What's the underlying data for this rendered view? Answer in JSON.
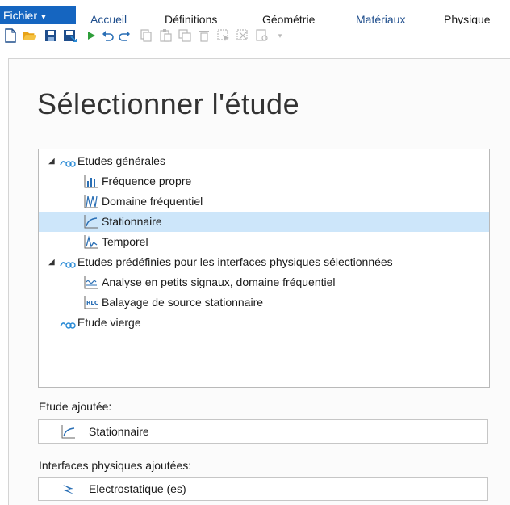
{
  "ribbon": {
    "file_tab": "Fichier",
    "tabs": [
      "Accueil",
      "Définitions",
      "Géométrie",
      "Matériaux",
      "Physique"
    ]
  },
  "toolbar": {
    "icons": [
      "new-file-icon",
      "open-folder-icon",
      "save-icon",
      "save-as-icon",
      "run-icon",
      "undo-icon",
      "redo-icon",
      "copy-icon",
      "paste-icon",
      "duplicate-icon",
      "delete-icon",
      "select-icon",
      "deselect-icon",
      "filter-icon",
      "dropdown-icon"
    ]
  },
  "page": {
    "title": "Sélectionner l'étude"
  },
  "tree": {
    "items": [
      {
        "label": "Etudes générales",
        "level": 0,
        "expanded": true
      },
      {
        "label": "Fréquence propre",
        "level": 1
      },
      {
        "label": "Domaine fréquentiel",
        "level": 1
      },
      {
        "label": "Stationnaire",
        "level": 1,
        "selected": true
      },
      {
        "label": "Temporel",
        "level": 1
      },
      {
        "label": "Etudes prédéfinies pour les interfaces physiques sélectionnées",
        "level": 0,
        "expanded": true
      },
      {
        "label": "Analyse en petits signaux, domaine fréquentiel",
        "level": 1
      },
      {
        "label": "Balayage de source stationnaire",
        "level": 1
      },
      {
        "label": "Etude vierge",
        "level": 0
      }
    ]
  },
  "added_study": {
    "heading": "Etude ajoutée:",
    "value": "Stationnaire"
  },
  "added_physics": {
    "heading": "Interfaces physiques ajoutées:",
    "value": "Electrostatique (es)"
  },
  "colors": {
    "accent": "#1565c0",
    "selection": "#cde6fa",
    "study_icon": "#2a8bd6"
  }
}
